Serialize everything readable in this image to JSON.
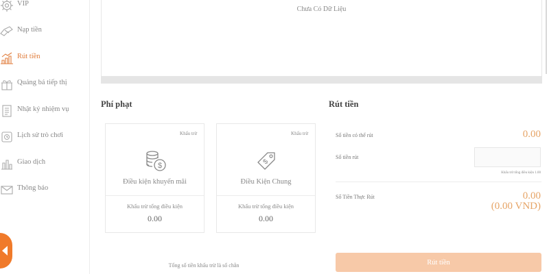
{
  "sidebar": {
    "items": [
      {
        "label": "VIP",
        "icon": "gear-icon"
      },
      {
        "label": "Nạp tiền",
        "icon": "deposit-icon"
      },
      {
        "label": "Rút tiền",
        "icon": "withdraw-icon",
        "active": true
      },
      {
        "label": "Quảng bá tiếp thị",
        "icon": "gift-icon"
      },
      {
        "label": "Nhật ký nhiệm vụ",
        "icon": "task-log-icon"
      },
      {
        "label": "Lịch sử trò chơi",
        "icon": "history-icon"
      },
      {
        "label": "Giao dịch",
        "icon": "transaction-icon"
      },
      {
        "label": "Thông báo",
        "icon": "mail-icon"
      }
    ],
    "accent_color": "#e07b39"
  },
  "top_panel": {
    "empty_text": "Chưa Có Dữ Liệu"
  },
  "penalty": {
    "title": "Phí phạt",
    "cards": [
      {
        "badge": "Khấu trừ",
        "title": "Điều kiện khuyến mãi",
        "sub_label": "Khấu trừ tổng điều kiện",
        "value": "0.00",
        "icon": "coins-icon"
      },
      {
        "badge": "Khấu trừ",
        "title": "Điều Kiện Chung",
        "sub_label": "Khấu trừ tổng điều kiện",
        "value": "0.00",
        "icon": "tag-icon"
      }
    ],
    "footnote": "Tổng số tiền khấu trừ là số chẵn"
  },
  "withdraw": {
    "title": "Rút tiền",
    "available_label": "Số tiền có thể rút",
    "available_value": "0.00",
    "amount_label": "Số tiền rút",
    "amount_value": "",
    "amount_note": "Khấu trừ tổng điều kiện 1.00",
    "actual_label": "Số Tiền Thực Rút",
    "actual_value": "0.00",
    "actual_vnd": "(0.00 VND)",
    "button_label": "Rút tiền",
    "button_color": "#f7c9a8"
  }
}
